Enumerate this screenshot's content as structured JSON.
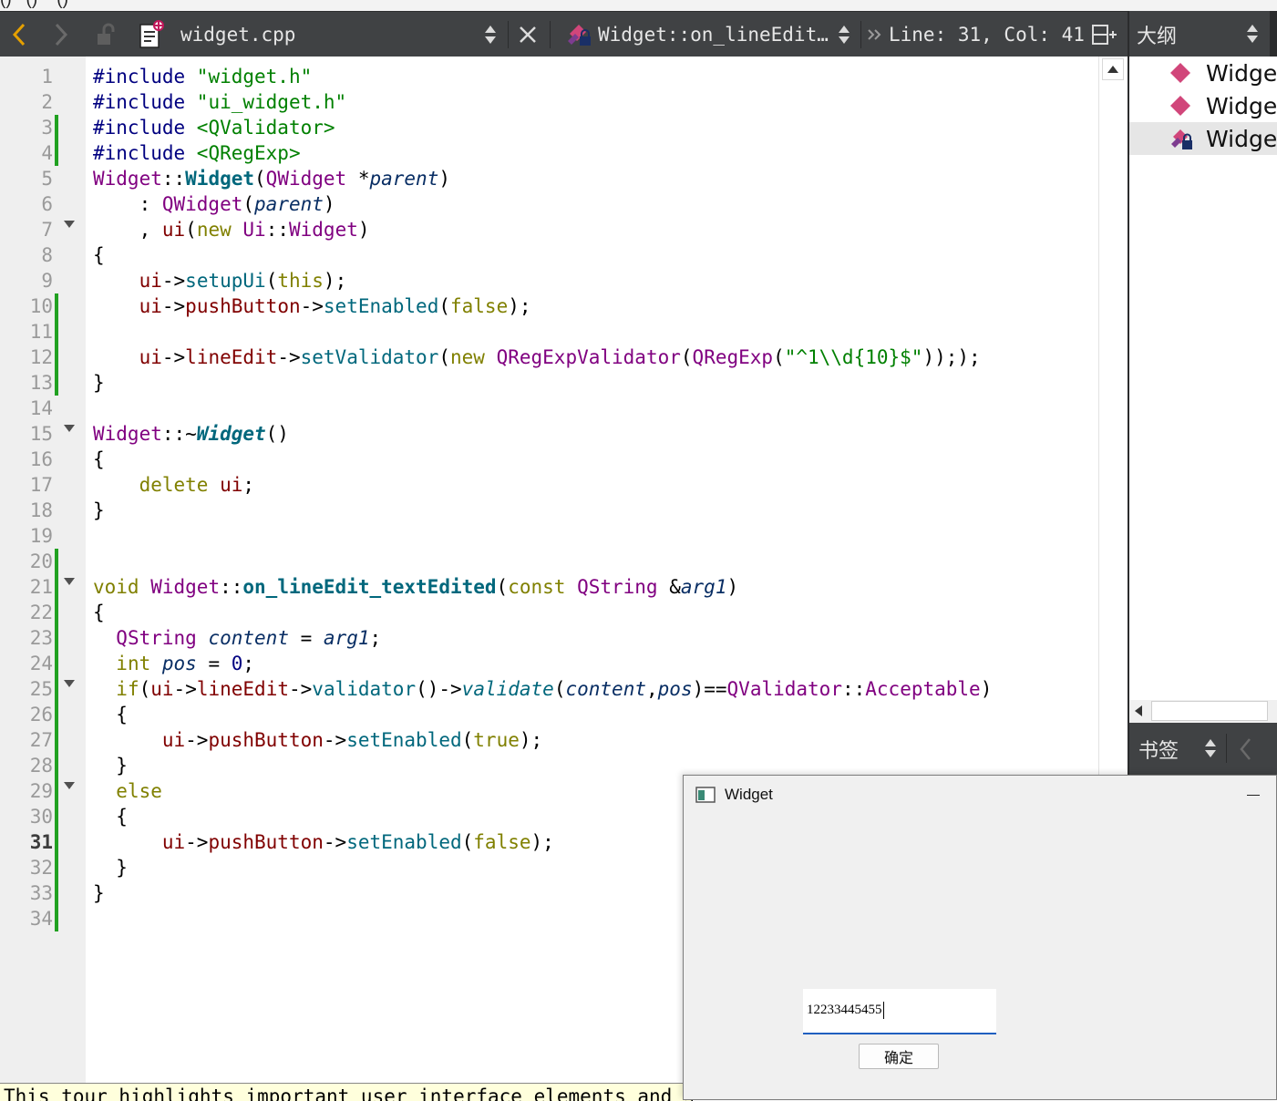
{
  "menu_strip": {
    "text": "()   ()    ()"
  },
  "toolbar": {
    "back_icon": "chevron-left-icon",
    "forward_icon": "chevron-right-icon",
    "file_name": "widget.cpp",
    "symbol_name": "Widget::on_lineEdit…",
    "position": "Line: 31, Col: 41",
    "split_icon": "split-add-icon"
  },
  "outline": {
    "title": "大纲",
    "items": [
      {
        "label": "Widget",
        "icon": "public-method-icon"
      },
      {
        "label": "Widget",
        "icon": "public-method-icon"
      },
      {
        "label": "Widget",
        "icon": "private-slot-icon"
      }
    ]
  },
  "bookmarks": {
    "title": "书签"
  },
  "editor": {
    "current_line": 31,
    "changed_lines": [
      3,
      4,
      10,
      11,
      12,
      13,
      20,
      21,
      22,
      23,
      24,
      25,
      26,
      27,
      28,
      29,
      30,
      31,
      32,
      33,
      34
    ],
    "fold_lines": [
      7,
      15,
      21,
      25,
      29
    ],
    "lines": [
      [
        [
          "c-pre",
          "#include "
        ],
        [
          "c-str",
          "\"widget.h\""
        ]
      ],
      [
        [
          "c-pre",
          "#include "
        ],
        [
          "c-str",
          "\"ui_widget.h\""
        ]
      ],
      [
        [
          "c-pre",
          "#include "
        ],
        [
          "c-str",
          "<QValidator>"
        ]
      ],
      [
        [
          "c-pre",
          "#include "
        ],
        [
          "c-str",
          "<QRegExp>"
        ]
      ],
      [
        [
          "c-type",
          "Widget"
        ],
        [
          "c-p",
          "::"
        ],
        [
          "c-fnb",
          "Widget"
        ],
        [
          "c-p",
          "("
        ],
        [
          "c-type",
          "QWidget"
        ],
        [
          "c-p",
          " *"
        ],
        [
          "c-it",
          "parent"
        ],
        [
          "c-p",
          ")"
        ]
      ],
      [
        [
          "c-p",
          "    : "
        ],
        [
          "c-type",
          "QWidget"
        ],
        [
          "c-p",
          "("
        ],
        [
          "c-it",
          "parent"
        ],
        [
          "c-p",
          ")"
        ]
      ],
      [
        [
          "c-p",
          "    , "
        ],
        [
          "c-mem",
          "ui"
        ],
        [
          "c-p",
          "("
        ],
        [
          "c-kw",
          "new"
        ],
        [
          "c-p",
          " "
        ],
        [
          "c-type",
          "Ui"
        ],
        [
          "c-p",
          "::"
        ],
        [
          "c-type",
          "Widget"
        ],
        [
          "c-p",
          ")"
        ]
      ],
      [
        [
          "c-p",
          "{"
        ]
      ],
      [
        [
          "c-p",
          "    "
        ],
        [
          "c-mem",
          "ui"
        ],
        [
          "c-p",
          "->"
        ],
        [
          "c-fn",
          "setupUi"
        ],
        [
          "c-p",
          "("
        ],
        [
          "c-kw",
          "this"
        ],
        [
          "c-p",
          ");"
        ]
      ],
      [
        [
          "c-p",
          "    "
        ],
        [
          "c-mem",
          "ui"
        ],
        [
          "c-p",
          "->"
        ],
        [
          "c-mem",
          "pushButton"
        ],
        [
          "c-p",
          "->"
        ],
        [
          "c-fn",
          "setEnabled"
        ],
        [
          "c-p",
          "("
        ],
        [
          "c-kw",
          "false"
        ],
        [
          "c-p",
          ");"
        ]
      ],
      [],
      [
        [
          "c-p",
          "    "
        ],
        [
          "c-mem",
          "ui"
        ],
        [
          "c-p",
          "->"
        ],
        [
          "c-mem",
          "lineEdit"
        ],
        [
          "c-p",
          "->"
        ],
        [
          "c-fn",
          "setValidator"
        ],
        [
          "c-p",
          "("
        ],
        [
          "c-kw",
          "new"
        ],
        [
          "c-p",
          " "
        ],
        [
          "c-type",
          "QRegExpValidator"
        ],
        [
          "c-p",
          "("
        ],
        [
          "c-type",
          "QRegExp"
        ],
        [
          "c-p",
          "("
        ],
        [
          "c-str",
          "\"^1\\\\d{10}$\""
        ],
        [
          "c-p",
          "));"
        ],
        [
          "c-p",
          ");"
        ]
      ],
      [
        [
          "c-p",
          "}"
        ]
      ],
      [],
      [
        [
          "c-type",
          "Widget"
        ],
        [
          "c-p",
          "::~"
        ],
        [
          "c-fnbi",
          "Widget"
        ],
        [
          "c-p",
          "()"
        ]
      ],
      [
        [
          "c-p",
          "{"
        ]
      ],
      [
        [
          "c-p",
          "    "
        ],
        [
          "c-kw",
          "delete"
        ],
        [
          "c-p",
          " "
        ],
        [
          "c-mem",
          "ui"
        ],
        [
          "c-p",
          ";"
        ]
      ],
      [
        [
          "c-p",
          "}"
        ]
      ],
      [],
      [],
      [
        [
          "c-kw",
          "void"
        ],
        [
          "c-p",
          " "
        ],
        [
          "c-type",
          "Widget"
        ],
        [
          "c-p",
          "::"
        ],
        [
          "c-fnb",
          "on_lineEdit_textEdited"
        ],
        [
          "c-p",
          "("
        ],
        [
          "c-kw",
          "const"
        ],
        [
          "c-p",
          " "
        ],
        [
          "c-type",
          "QString"
        ],
        [
          "c-p",
          " &"
        ],
        [
          "c-it",
          "arg1"
        ],
        [
          "c-p",
          ")"
        ]
      ],
      [
        [
          "c-p",
          "{"
        ]
      ],
      [
        [
          "c-p",
          "  "
        ],
        [
          "c-type",
          "QString"
        ],
        [
          "c-p",
          " "
        ],
        [
          "c-it",
          "content"
        ],
        [
          "c-p",
          " = "
        ],
        [
          "c-it",
          "arg1"
        ],
        [
          "c-p",
          ";"
        ]
      ],
      [
        [
          "c-p",
          "  "
        ],
        [
          "c-kw",
          "int"
        ],
        [
          "c-p",
          " "
        ],
        [
          "c-it",
          "pos"
        ],
        [
          "c-p",
          " = "
        ],
        [
          "c-num",
          "0"
        ],
        [
          "c-p",
          ";"
        ]
      ],
      [
        [
          "c-p",
          "  "
        ],
        [
          "c-kw",
          "if"
        ],
        [
          "c-p",
          "("
        ],
        [
          "c-mem",
          "ui"
        ],
        [
          "c-p",
          "->"
        ],
        [
          "c-mem",
          "lineEdit"
        ],
        [
          "c-p",
          "->"
        ],
        [
          "c-fn",
          "validator"
        ],
        [
          "c-p",
          "()->"
        ],
        [
          "c-fni",
          "validate"
        ],
        [
          "c-p",
          "("
        ],
        [
          "c-it",
          "content"
        ],
        [
          "c-p",
          ","
        ],
        [
          "c-it",
          "pos"
        ],
        [
          "c-p",
          ")=="
        ],
        [
          "c-type",
          "QValidator"
        ],
        [
          "c-p",
          "::"
        ],
        [
          "c-type",
          "Acceptable"
        ],
        [
          "c-p",
          ")"
        ]
      ],
      [
        [
          "c-p",
          "  {"
        ]
      ],
      [
        [
          "c-p",
          "      "
        ],
        [
          "c-mem",
          "ui"
        ],
        [
          "c-p",
          "->"
        ],
        [
          "c-mem",
          "pushButton"
        ],
        [
          "c-p",
          "->"
        ],
        [
          "c-fn",
          "setEnabled"
        ],
        [
          "c-p",
          "("
        ],
        [
          "c-kw",
          "true"
        ],
        [
          "c-p",
          ");"
        ]
      ],
      [
        [
          "c-p",
          "  }"
        ]
      ],
      [
        [
          "c-p",
          "  "
        ],
        [
          "c-kw",
          "else"
        ]
      ],
      [
        [
          "c-p",
          "  {"
        ]
      ],
      [
        [
          "c-p",
          "      "
        ],
        [
          "c-mem",
          "ui"
        ],
        [
          "c-p",
          "->"
        ],
        [
          "c-mem",
          "pushButton"
        ],
        [
          "c-p",
          "->"
        ],
        [
          "c-fn",
          "setEnabled"
        ],
        [
          "c-p",
          "("
        ],
        [
          "c-kw",
          "false"
        ],
        [
          "c-p",
          ");"
        ]
      ],
      [
        [
          "c-p",
          "  }"
        ]
      ],
      [
        [
          "c-p",
          "}"
        ]
      ],
      []
    ]
  },
  "tour_tip": "This tour highlights important user interface elements and shows",
  "widget_window": {
    "title": "Widget",
    "line_edit_value": "12233445455",
    "button_label": "确定"
  }
}
